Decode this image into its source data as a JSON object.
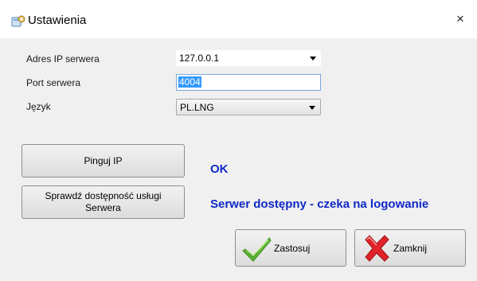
{
  "window": {
    "title": "Ustawienia",
    "close_label": "×",
    "icon": "settings-window-icon"
  },
  "form": {
    "server_ip": {
      "label": "Adres IP serwera",
      "value": "127.0.0.1"
    },
    "server_port": {
      "label": "Port serwera",
      "value": "4004"
    },
    "language": {
      "label": "Język",
      "value": "PL.LNG"
    }
  },
  "buttons": {
    "ping": "Pinguj IP",
    "check_service": "Sprawdź dostępność usługi Serwera",
    "apply": "Zastosuj",
    "close": "Zamknij"
  },
  "icons": {
    "apply": "green-checkmark-icon",
    "close": "red-x-icon"
  },
  "status": {
    "ping_result": "OK",
    "service_result": "Serwer dostępny - czeka na logowanie"
  },
  "colors": {
    "status_text": "#0f28c8",
    "selection": "#3399ff"
  }
}
